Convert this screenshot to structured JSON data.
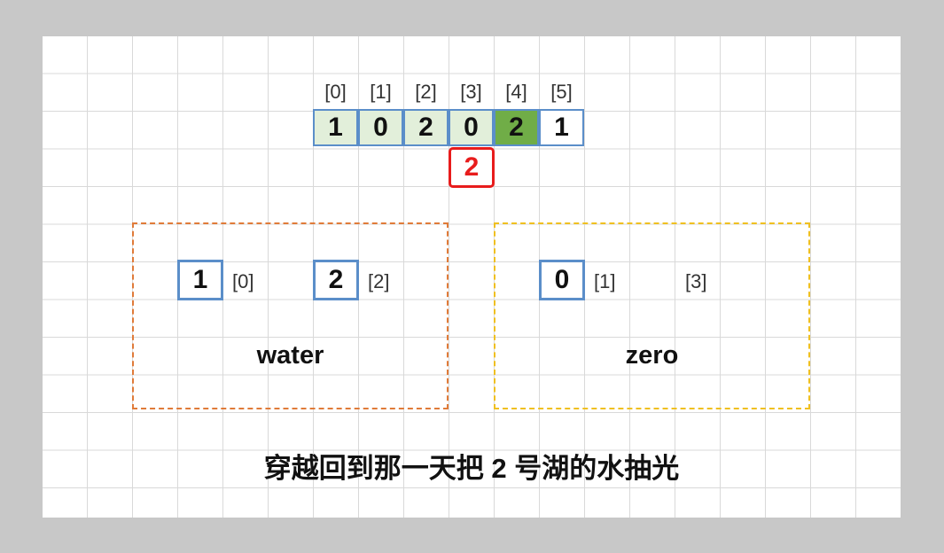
{
  "array": {
    "indices": [
      "[0]",
      "[1]",
      "[2]",
      "[3]",
      "[4]",
      "[5]"
    ],
    "values": [
      "1",
      "0",
      "2",
      "0",
      "2",
      "1"
    ],
    "cell_styles": [
      "light",
      "light",
      "light",
      "light",
      "dark",
      "plain"
    ]
  },
  "pointer": {
    "value": "2",
    "color": "#e81c1c"
  },
  "groups": {
    "water": {
      "title": "water",
      "border_color": "#e07b39",
      "items": [
        {
          "value": "1",
          "index": "[0]"
        },
        {
          "value": "2",
          "index": "[2]"
        }
      ]
    },
    "zero": {
      "title": "zero",
      "border_color": "#f0c020",
      "items": [
        {
          "value": "0",
          "index": "[1]"
        }
      ],
      "extra_index": "[3]"
    }
  },
  "caption": "穿越回到那一天把 2 号湖的水抽光",
  "colors": {
    "cell_border": "#5b8ec9",
    "light_fill": "#e2efda",
    "dark_fill": "#70ad47"
  }
}
